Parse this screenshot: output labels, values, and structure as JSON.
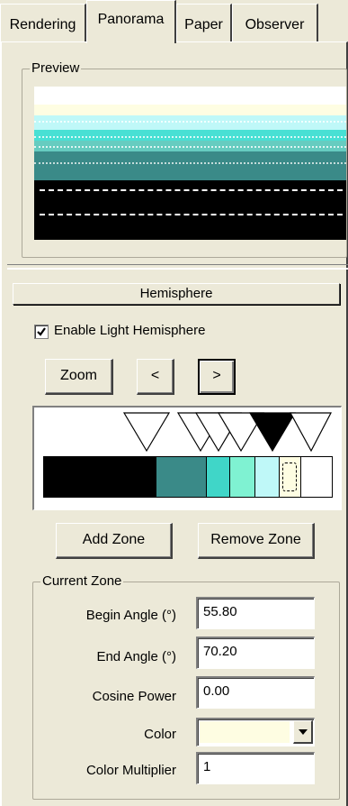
{
  "tabs": [
    {
      "label": "Rendering"
    },
    {
      "label": "Panorama"
    },
    {
      "label": "Paper"
    },
    {
      "label": "Observer"
    }
  ],
  "preview": {
    "title": "Preview",
    "bands": [
      "#ffffff",
      "#fefde2",
      "#bff8f8",
      "#48e0d4",
      "#66ccc0",
      "#3a8a88",
      "#0f5e60",
      "#000000",
      "#000000"
    ]
  },
  "hemisphere": {
    "header": "Hemisphere",
    "enable_label": "Enable Light Hemisphere",
    "enable_checked": true,
    "zoom_label": "Zoom",
    "prev_label": "<",
    "next_label": ">",
    "zones": [
      {
        "color": "#000000"
      },
      {
        "color": "#3a8a88"
      },
      {
        "color": "#40d6c8"
      },
      {
        "color": "#7ff2d2"
      },
      {
        "color": "#bff8f8"
      },
      {
        "color": "#fefde2",
        "selected": true
      },
      {
        "color": "#ffffff"
      }
    ],
    "add_zone_label": "Add Zone",
    "remove_zone_label": "Remove Zone"
  },
  "current_zone": {
    "title": "Current Zone",
    "begin_angle_label": "Begin Angle (°)",
    "begin_angle_value": "55.80",
    "end_angle_label": "End Angle (°)",
    "end_angle_value": "70.20",
    "cosine_power_label": "Cosine Power",
    "cosine_power_value": "0.00",
    "color_label": "Color",
    "color_value": "#fefde2",
    "color_multiplier_label": "Color Multiplier",
    "color_multiplier_value": "1"
  }
}
